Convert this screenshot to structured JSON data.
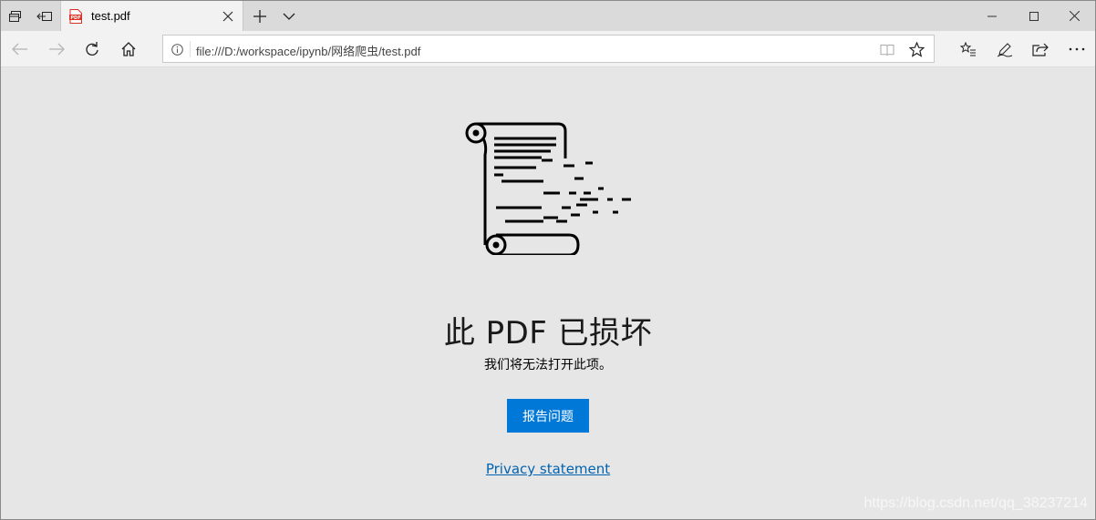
{
  "tab": {
    "title": "test.pdf",
    "favicon_label": "PDF"
  },
  "address_bar": {
    "url": "file:///D:/workspace/ipynb/网络爬虫/test.pdf"
  },
  "error_page": {
    "heading": "此 PDF 已损坏",
    "subtext": "我们将无法打开此项。",
    "report_button": "报告问题",
    "privacy_link": "Privacy statement"
  },
  "watermark": "https://blog.csdn.net/qq_38237214",
  "colors": {
    "accent": "#0078d7",
    "link": "#0063b1",
    "page_bg": "#e6e6e6",
    "favicon_red": "#d93025"
  }
}
